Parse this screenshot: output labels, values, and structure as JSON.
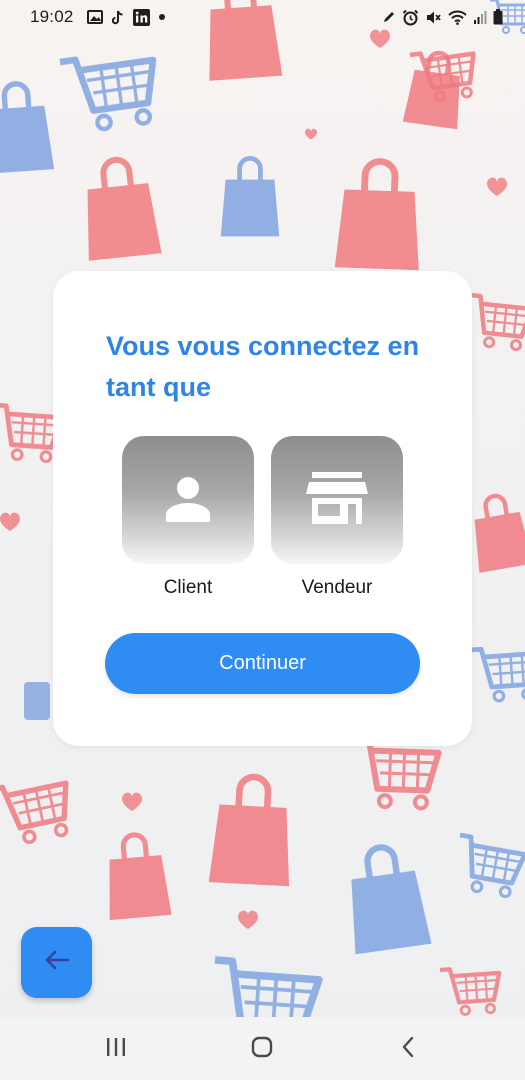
{
  "status_bar": {
    "time": "19:02",
    "left_icons": [
      "gallery-icon",
      "tiktok-icon",
      "linkedin-icon",
      "dot-icon"
    ],
    "right_icons": [
      "pen-icon",
      "alarm-icon",
      "mute-icon",
      "wifi-icon",
      "signal-icon",
      "battery-icon"
    ]
  },
  "card": {
    "title": "Vous vous connectez en tant que",
    "options": [
      {
        "label": "Client",
        "icon": "person-icon"
      },
      {
        "label": "Vendeur",
        "icon": "store-icon"
      }
    ],
    "continue_label": "Continuer"
  },
  "back_button": {
    "icon": "arrow-left-icon"
  },
  "nav_bar": {
    "icons": [
      "recents-icon",
      "home-icon",
      "back-icon"
    ]
  },
  "colors": {
    "accent": "#2f8cf3",
    "title": "#2f84e8",
    "tile_gray": "#9a9a9a",
    "background_red": "#f07a80",
    "background_blue": "#7fa3e0"
  },
  "background": {
    "pattern_icons": [
      "shopping-bag-icon",
      "shopping-cart-icon",
      "heart-icon"
    ]
  }
}
